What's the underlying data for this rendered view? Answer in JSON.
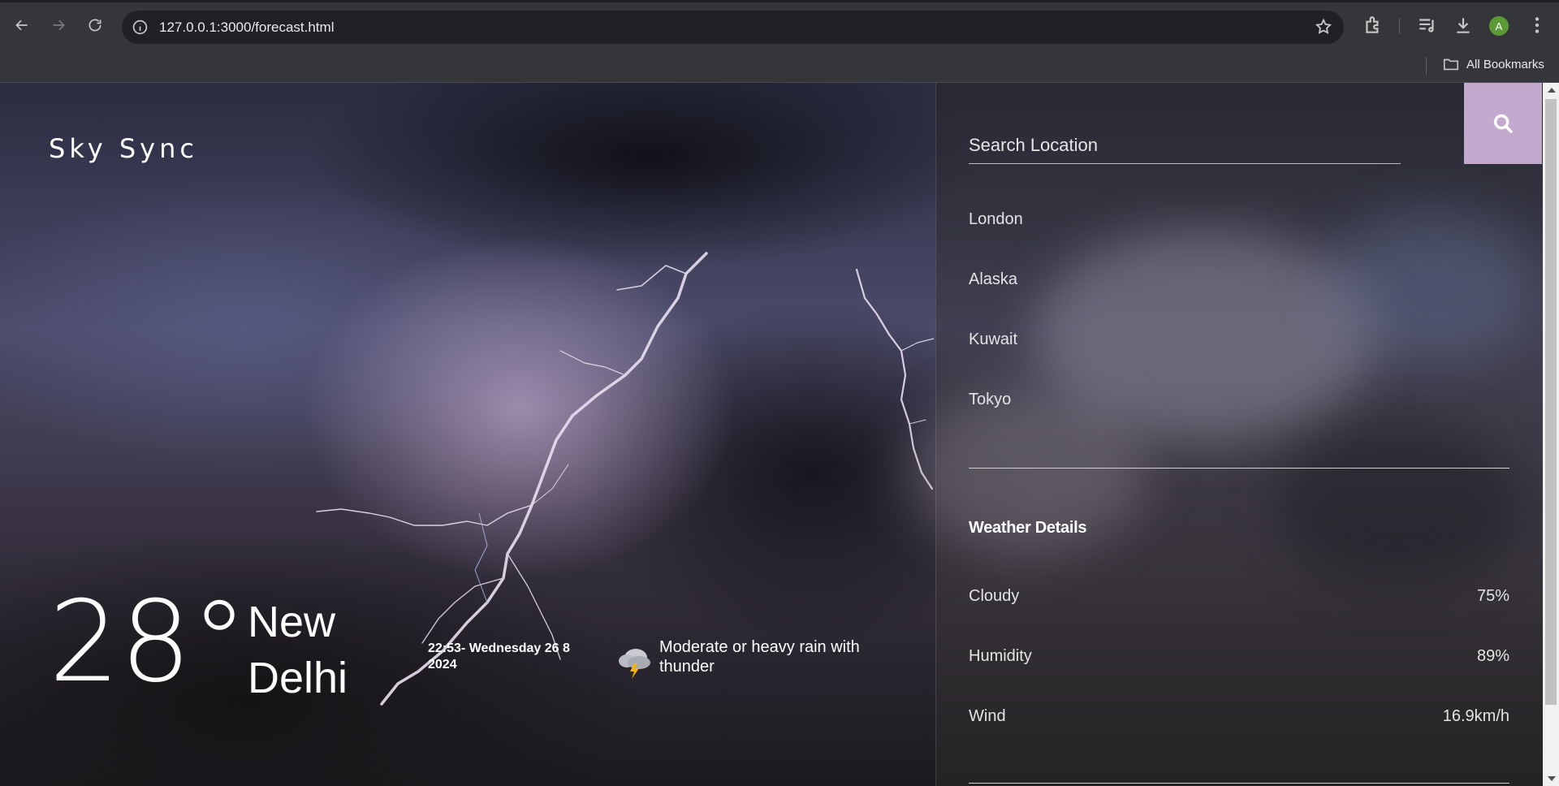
{
  "browser": {
    "url": "127.0.0.1:3000/forecast.html",
    "avatar_letter": "A",
    "bookmarks_label": "All Bookmarks"
  },
  "app": {
    "brand": "Sky Sync"
  },
  "current": {
    "temperature": "28",
    "degree_symbol": "°",
    "city": "New Delhi",
    "datetime": "22:53- Wednesday 26 8 2024",
    "condition": "Moderate or heavy rain with thunder",
    "condition_icon": "thunder-rain-cloud-icon"
  },
  "search": {
    "placeholder": "Search Location",
    "value": ""
  },
  "locations": [
    "London",
    "Alaska",
    "Kuwait",
    "Tokyo"
  ],
  "details": {
    "title": "Weather Details",
    "rows": [
      {
        "label": "Cloudy",
        "value": "75%"
      },
      {
        "label": "Humidity",
        "value": "89%"
      },
      {
        "label": "Wind",
        "value": "16.9km/h"
      }
    ]
  },
  "colors": {
    "search_button": "#c4a9cf",
    "chrome_bg": "#35363a",
    "omnibox_bg": "#202124"
  }
}
